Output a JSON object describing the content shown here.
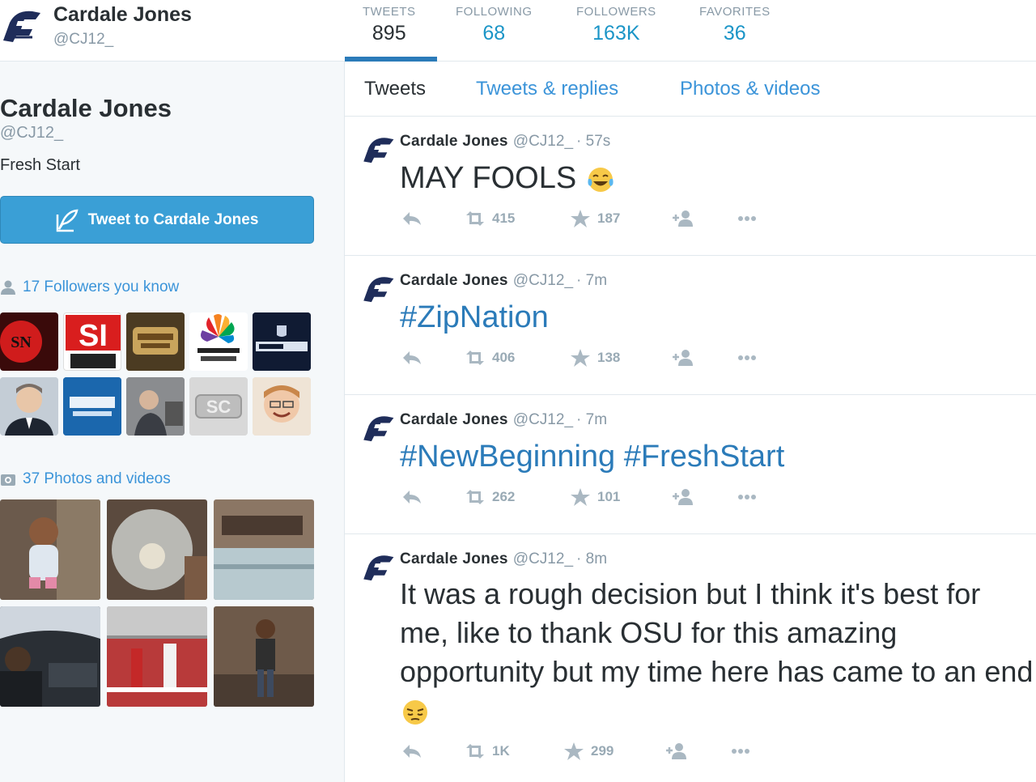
{
  "profile": {
    "name": "Cardale Jones",
    "handle": "@CJ12_",
    "bio": "Fresh Start",
    "tweet_to_label": "Tweet to Cardale Jones"
  },
  "stats": [
    {
      "label": "TWEETS",
      "value": "895"
    },
    {
      "label": "FOLLOWING",
      "value": "68"
    },
    {
      "label": "FOLLOWERS",
      "value": "163K"
    },
    {
      "label": "FAVORITES",
      "value": "36"
    }
  ],
  "tabs": [
    "Tweets",
    "Tweets & replies",
    "Photos & videos"
  ],
  "followers_you_know": {
    "label": "17 Followers you know",
    "icon": "person-icon"
  },
  "photos_videos": {
    "label": "37 Photos and videos",
    "icon": "camera-icon"
  },
  "tweets": [
    {
      "name": "Cardale Jones",
      "handle": "@CJ12_",
      "time": "· 57s",
      "text": "MAY FOOLS",
      "emoji": "laughing-tears",
      "retweets": "415",
      "favorites": "187"
    },
    {
      "name": "Cardale Jones",
      "handle": "@CJ12_",
      "time": "· 7m",
      "text": "#ZipNation",
      "emoji": "",
      "retweets": "406",
      "favorites": "138"
    },
    {
      "name": "Cardale Jones",
      "handle": "@CJ12_",
      "time": "· 7m",
      "text": "#NewBeginning #FreshStart",
      "emoji": "",
      "retweets": "262",
      "favorites": "101"
    },
    {
      "name": "Cardale Jones",
      "handle": "@CJ12_",
      "time": "· 8m",
      "text": "It was a rough decision but I think it's best for me, like to thank OSU for this amazing opportunity but my time here has came to an end",
      "emoji": "pensive-face",
      "retweets": "1K",
      "favorites": "299"
    }
  ],
  "colors": {
    "accent": "#3b94d9",
    "button": "#3a9fd6",
    "muted": "#8899a6",
    "text": "#292f33"
  }
}
